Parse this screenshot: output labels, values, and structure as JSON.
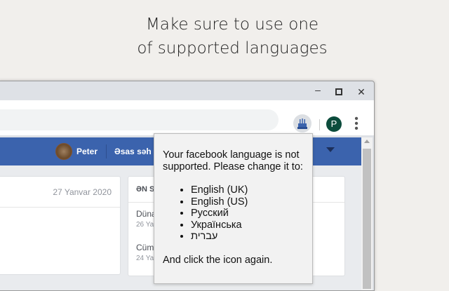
{
  "headline": [
    "Make sure to use one",
    "of supported languages"
  ],
  "window": {
    "minimize": "–",
    "maximize": "☐",
    "close": "✕"
  },
  "profile_initial": "P",
  "fb": {
    "user": "Peter",
    "home": "Əsas səh"
  },
  "left_card": {
    "date": "27 Yanvar 2020"
  },
  "right_card": {
    "header": "ƏN S",
    "items": [
      {
        "title": "Düna",
        "date": "26 Ya"
      },
      {
        "title": "Cüm",
        "date": "24 Ya"
      }
    ]
  },
  "popup": {
    "intro": "Your facebook language is not supported. Please change it to:",
    "languages": [
      "English (UK)",
      "English (US)",
      "Русский",
      "Українська",
      "עברית"
    ],
    "outro": "And click the icon again."
  }
}
